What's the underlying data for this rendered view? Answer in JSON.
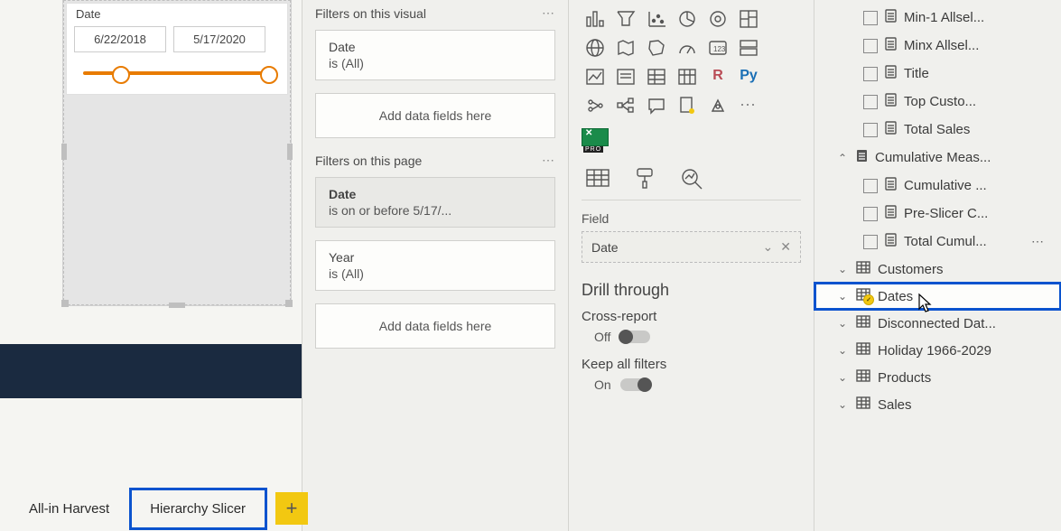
{
  "slicer": {
    "title": "Date",
    "date_start": "6/22/2018",
    "date_end": "5/17/2020"
  },
  "tabs": {
    "all_in_harvest": "All-in Harvest",
    "hierarchy_slicer": "Hierarchy Slicer",
    "add_glyph": "+"
  },
  "filters": {
    "visual_header": "Filters on this visual",
    "visual_card": {
      "title": "Date",
      "sub": "is (All)"
    },
    "visual_drop": "Add data fields here",
    "page_header": "Filters on this page",
    "page_card_date": {
      "title": "Date",
      "sub": "is on or before 5/17/..."
    },
    "page_card_year": {
      "title": "Year",
      "sub": "is (All)"
    },
    "page_drop": "Add data fields here"
  },
  "viz": {
    "field_section": "Field",
    "field_well_value": "Date",
    "drill_through": "Drill through",
    "cross_report": "Cross-report",
    "cross_report_state": "Off",
    "keep_filters": "Keep all filters",
    "keep_filters_state": "On"
  },
  "fields_list": {
    "items_measures": [
      "Min-1 Allsel...",
      "Minx Allsel...",
      "Title",
      "Top Custo...",
      "Total Sales"
    ],
    "cumulative_header": "Cumulative Meas...",
    "cumulative_children": [
      "Cumulative ...",
      "Pre-Slicer C...",
      "Total Cumul..."
    ],
    "tables": [
      "Customers",
      "Dates",
      "Disconnected Dat...",
      "Holiday 1966-2029",
      "Products",
      "Sales"
    ]
  }
}
